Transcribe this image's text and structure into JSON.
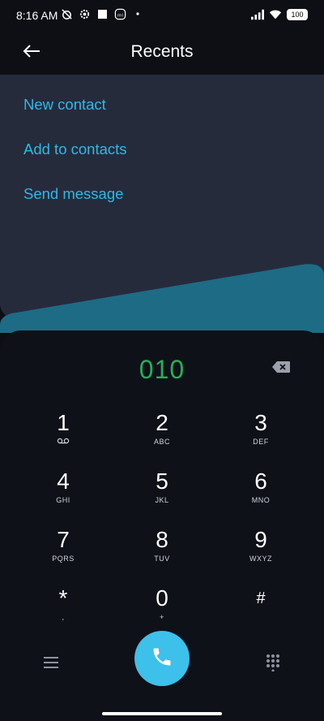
{
  "status_bar": {
    "time": "8:16 AM",
    "battery": "100",
    "icons_left": [
      "alarm-off-icon",
      "settings-gear-icon",
      "square-icon",
      "mi-icon",
      "dot-icon"
    ],
    "icons_right": [
      "signal-icon",
      "wifi-icon",
      "battery-icon"
    ]
  },
  "header": {
    "title": "Recents",
    "back_icon": "arrow-left-icon"
  },
  "options": [
    {
      "label": "New contact"
    },
    {
      "label": "Add to contacts"
    },
    {
      "label": "Send message"
    }
  ],
  "dialer": {
    "number": "010",
    "keys": [
      {
        "digit": "1",
        "sub": "voicemail"
      },
      {
        "digit": "2",
        "sub": "ABC"
      },
      {
        "digit": "3",
        "sub": "DEF"
      },
      {
        "digit": "4",
        "sub": "GHI"
      },
      {
        "digit": "5",
        "sub": "JKL"
      },
      {
        "digit": "6",
        "sub": "MNO"
      },
      {
        "digit": "7",
        "sub": "PQRS"
      },
      {
        "digit": "8",
        "sub": "TUV"
      },
      {
        "digit": "9",
        "sub": "WXYZ"
      },
      {
        "digit": "*",
        "sub": ","
      },
      {
        "digit": "0",
        "sub": "+"
      },
      {
        "digit": "#",
        "sub": ""
      }
    ]
  },
  "colors": {
    "accent": "#2fb8e6",
    "number": "#20b25a",
    "call_button": "#3dc0ea",
    "panel": "#262b3c",
    "background": "#0d0f14"
  }
}
